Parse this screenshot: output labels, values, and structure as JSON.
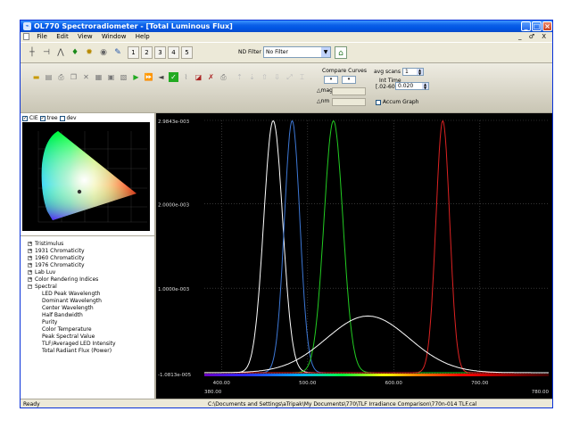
{
  "window": {
    "title": "OL770 Spectroradiometer - [Total Luminous Flux]",
    "app_icon": "spectro-icon"
  },
  "menu": {
    "items": [
      "File",
      "Edit",
      "View",
      "Window",
      "Help"
    ],
    "mdi_controls": "_ ♂ X"
  },
  "toolbar1": {
    "number_buttons": [
      "1",
      "2",
      "3",
      "4",
      "5"
    ],
    "nd_filter_label": "ND Filter",
    "nd_filter_value": "No Filter"
  },
  "toolbar2": {
    "compare_title": "Compare Curves",
    "mag_label": "mag",
    "nm_label": "nm",
    "avg_scans_label": "avg scans",
    "avg_scans_value": "1",
    "int_time_label": "Int Time",
    "int_time_range": "[.02-60]",
    "int_time_value": "0.020",
    "accum_label": "Accum Graph"
  },
  "cie_panel": {
    "cie_label": "CIE",
    "tree_label": "tree",
    "dev_label": "dev"
  },
  "tree": {
    "top": [
      "Tristimulus",
      "1931 Chromaticity",
      "1960 Chromaticity",
      "1976 Chromaticity",
      "Lab Luv",
      "Color Rendering Indices",
      "Spectral"
    ],
    "spectral_children": [
      "LED Peak Wavelength",
      "Dominant Wavelength",
      "Center Wavelength",
      "Half Bandwidth",
      "Purity",
      "Color Temperature",
      "Peak Spectral Value",
      "TLF/Averaged LED Intensity",
      "Total Radiant Flux (Power)"
    ]
  },
  "status": {
    "ready": "Ready",
    "path": "C:\\Documents and Settings\\aTripak\\My Documents\\770\\TLF Irradiance Comparison\\770n-014 TLF.cal"
  },
  "chart_data": {
    "type": "line",
    "y_ticks": [
      "2.9843e-003",
      "2.0000e-003",
      "1.0000e-003",
      "-1.0813e-005"
    ],
    "x_ticks": [
      "380.00",
      "400.00",
      "500.00",
      "600.00",
      "700.00",
      "780.00"
    ],
    "xlim": [
      380,
      780
    ],
    "ylim": [
      -1.08e-05,
      0.0029843
    ],
    "grid": true,
    "series": [
      {
        "color": "#ffffff",
        "peak_nm": 460,
        "peak_value": 0.00298,
        "width_nm": 11
      },
      {
        "color": "#3d78d6",
        "peak_nm": 482,
        "peak_value": 0.00298,
        "width_nm": 9
      },
      {
        "color": "#22cc22",
        "peak_nm": 530,
        "peak_value": 0.00298,
        "width_nm": 11
      },
      {
        "color": "#dd2222",
        "peak_nm": 657,
        "peak_value": 0.00298,
        "width_nm": 8
      },
      {
        "color": "#ffffff",
        "peak_nm": 570,
        "peak_value": 0.00067,
        "width_nm": 48
      }
    ]
  }
}
